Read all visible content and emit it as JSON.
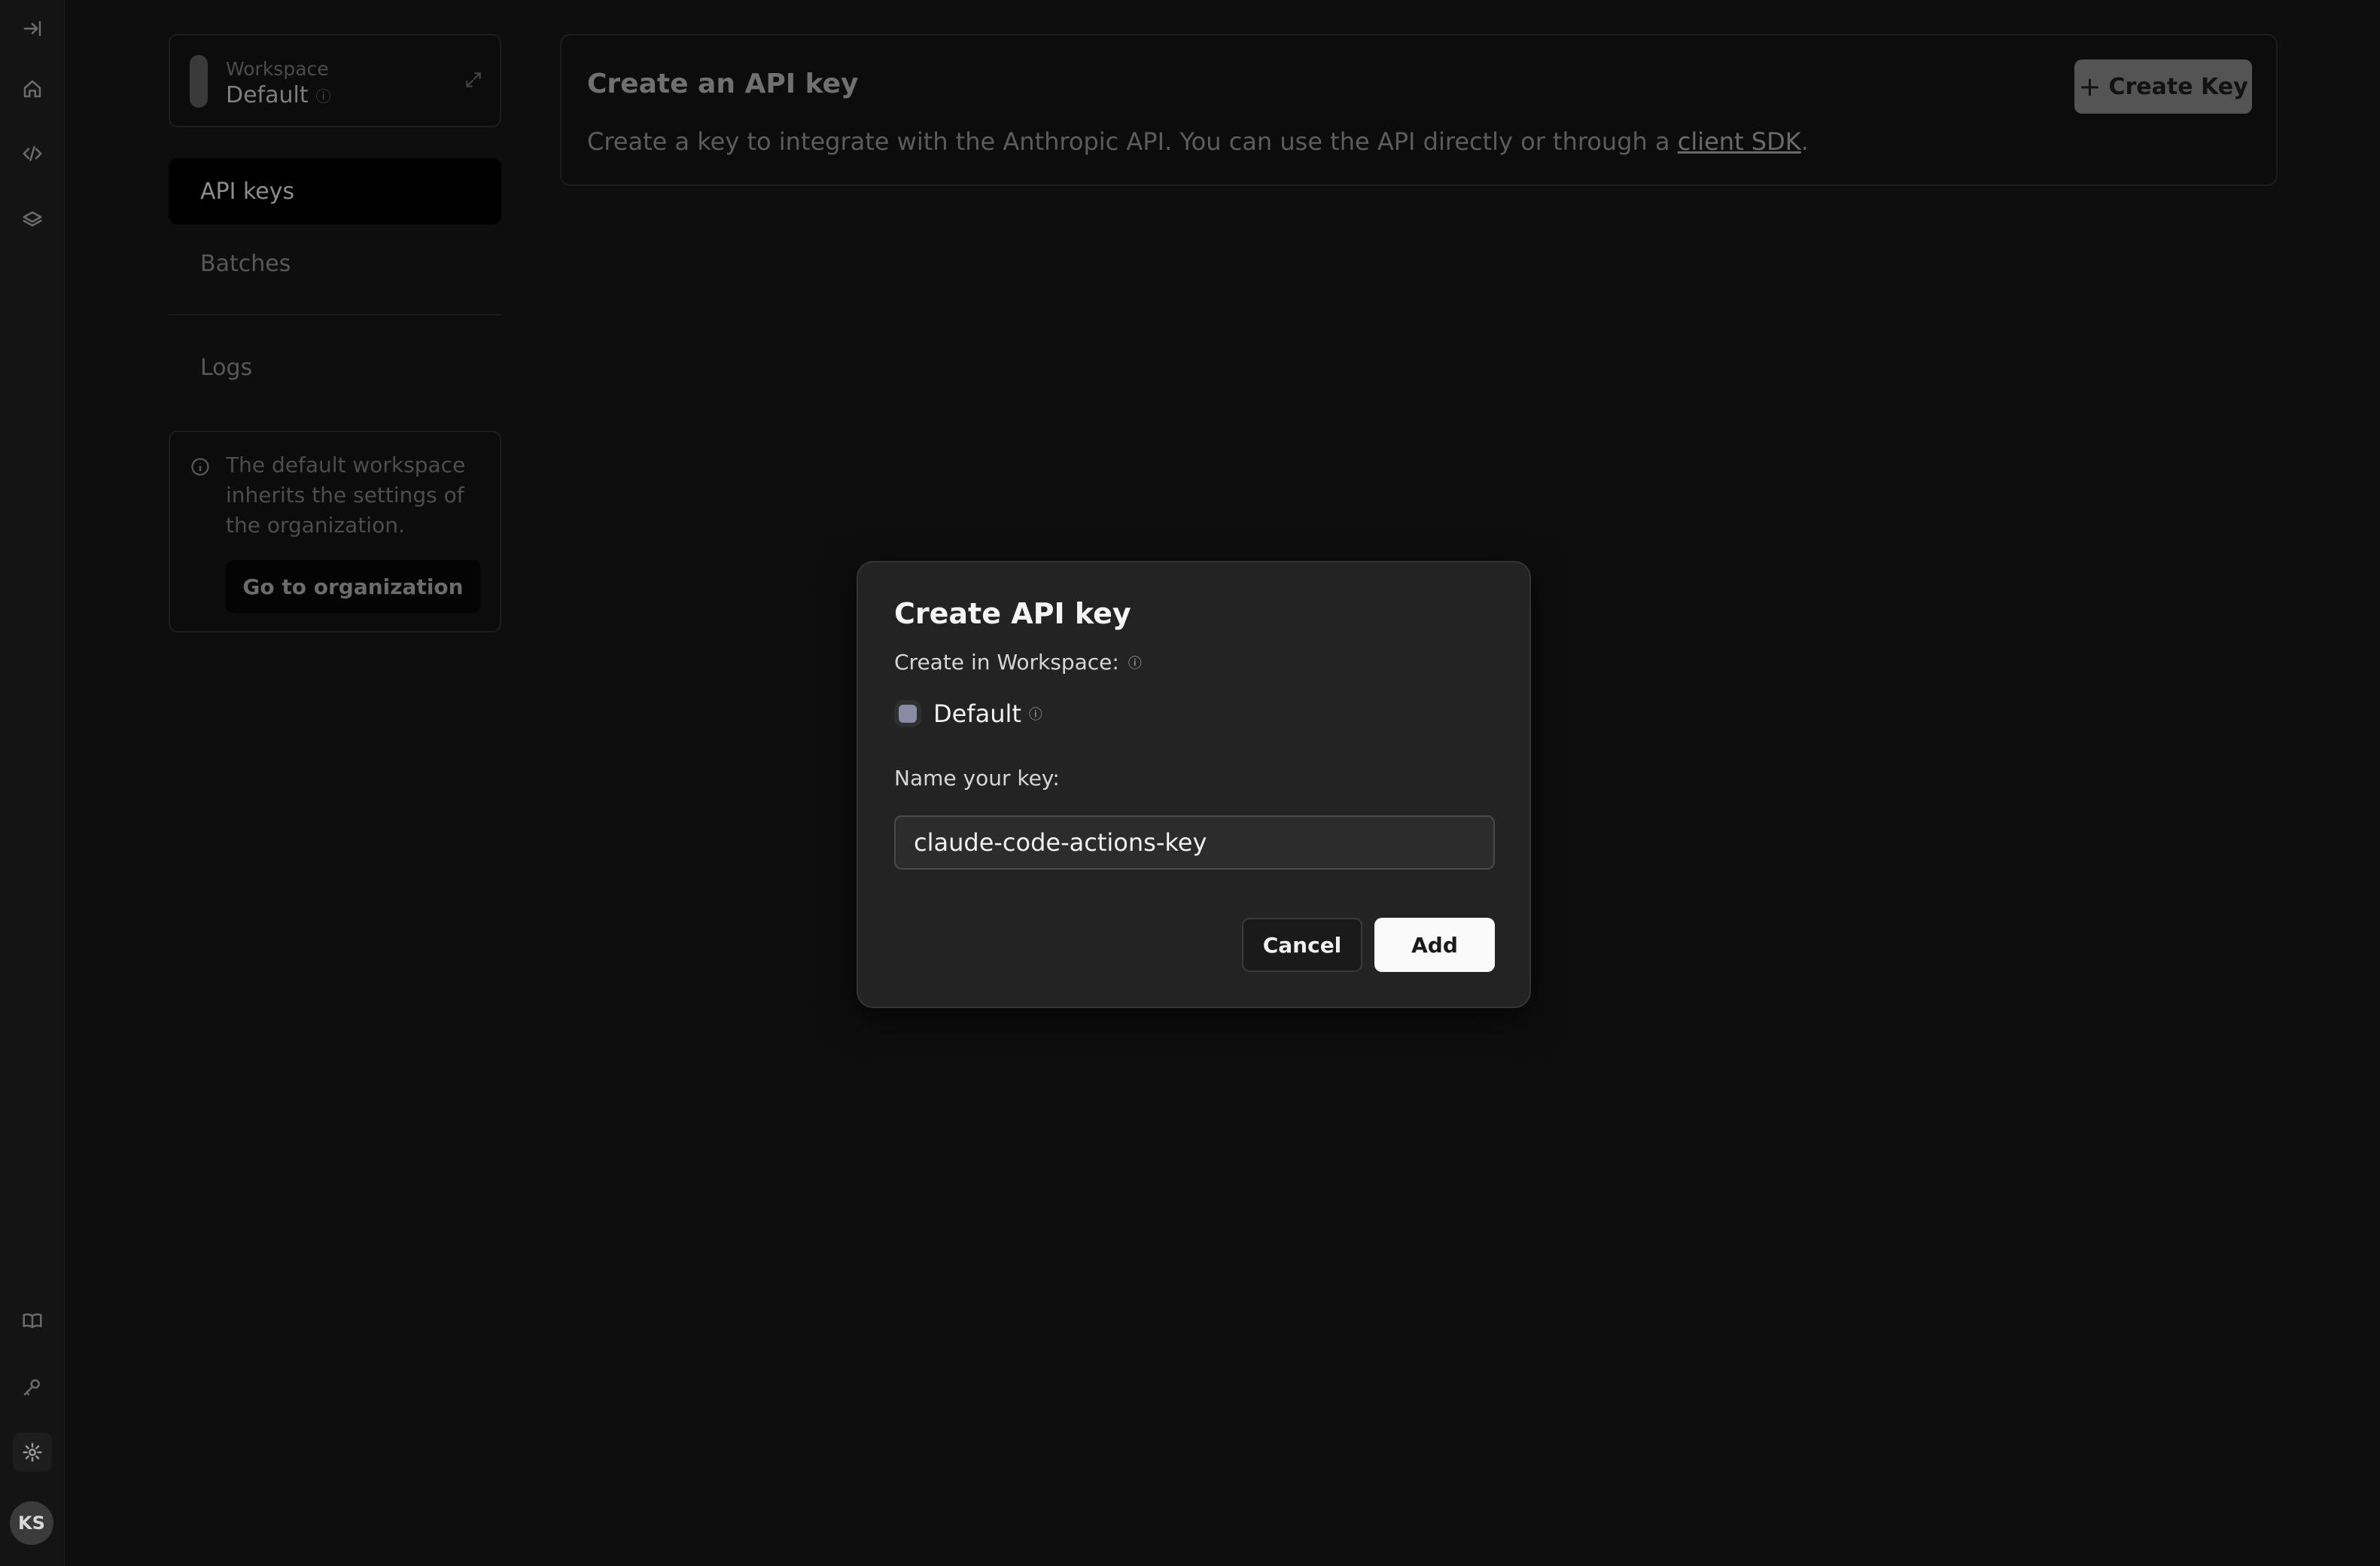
{
  "rail": {
    "avatar_initials": "KS",
    "icons": [
      "collapse-sidebar-icon",
      "home-icon",
      "code-icon",
      "layers-icon",
      "book-icon",
      "key-icon",
      "gear-icon"
    ]
  },
  "workspace": {
    "label": "Workspace",
    "name": "Default"
  },
  "nav": {
    "items": [
      {
        "label": "API keys"
      },
      {
        "label": "Batches"
      },
      {
        "label": "Logs"
      }
    ]
  },
  "notice": {
    "text": "The default workspace inherits the settings of the organization.",
    "button_label": "Go to organization"
  },
  "main": {
    "title": "Create an API key",
    "description_prefix": "Create a key to integrate with the Anthropic API. You can use the API directly or through a ",
    "description_link": "client SDK",
    "description_suffix": ".",
    "create_button_label": "Create Key"
  },
  "modal": {
    "title": "Create API key",
    "workspace_label": "Create in Workspace:",
    "workspace_value": "Default",
    "name_label": "Name your key:",
    "name_value": "claude-code-actions-key",
    "cancel_label": "Cancel",
    "add_label": "Add"
  },
  "colors": {
    "background": "#0e0e0e",
    "modal_bg": "#232323",
    "primary_button": "#fafafa",
    "workspace_swatch": "#8a8aa5"
  }
}
